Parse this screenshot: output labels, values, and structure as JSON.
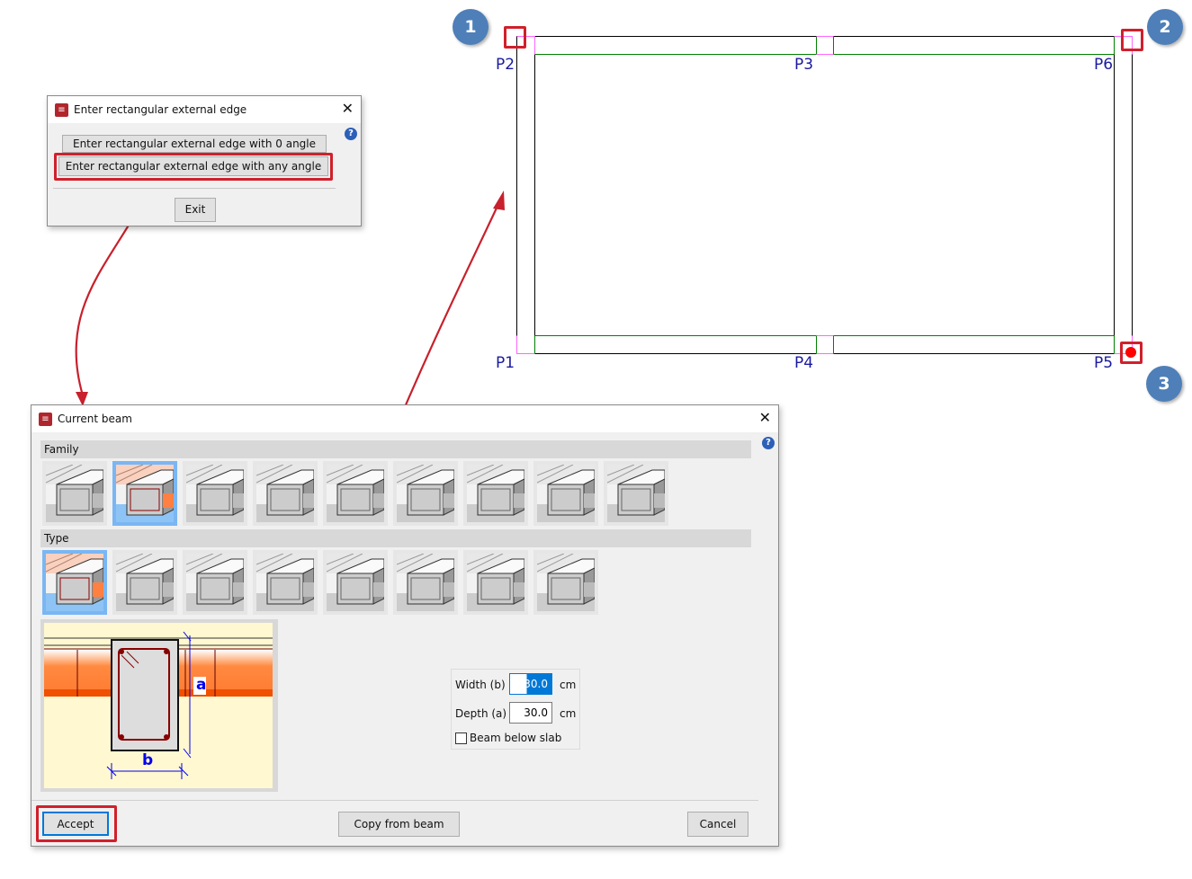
{
  "edge_dialog": {
    "title": "Enter rectangular external edge",
    "btn_zero_angle": "Enter rectangular external edge with 0 angle",
    "btn_any_angle": "Enter rectangular external edge with any angle",
    "exit": "Exit",
    "help": "?"
  },
  "beam_dialog": {
    "title": "Current beam",
    "family_label": "Family",
    "type_label": "Type",
    "help": "?",
    "width_label": "Width (b)",
    "width_value": "30.0",
    "width_unit": "cm",
    "depth_label": "Depth (a)",
    "depth_value": "30.0",
    "depth_unit": "cm",
    "below_slab_label": "Beam below slab",
    "below_slab_checked": false,
    "diagram_a": "a",
    "diagram_b": "b",
    "accept": "Accept",
    "copy": "Copy from beam",
    "cancel": "Cancel",
    "family_count": 9,
    "family_selected": 2,
    "type_count": 8,
    "type_selected": 1
  },
  "drawing": {
    "points": [
      "P1",
      "P2",
      "P3",
      "P4",
      "P5",
      "P6"
    ],
    "badges": [
      "1",
      "2",
      "3"
    ]
  },
  "colors": {
    "highlight": "#d0202c",
    "badge": "#4e7fb8",
    "point_label": "#1a1aa0",
    "beam_line": "#008000",
    "guide": "#ff66ff"
  }
}
